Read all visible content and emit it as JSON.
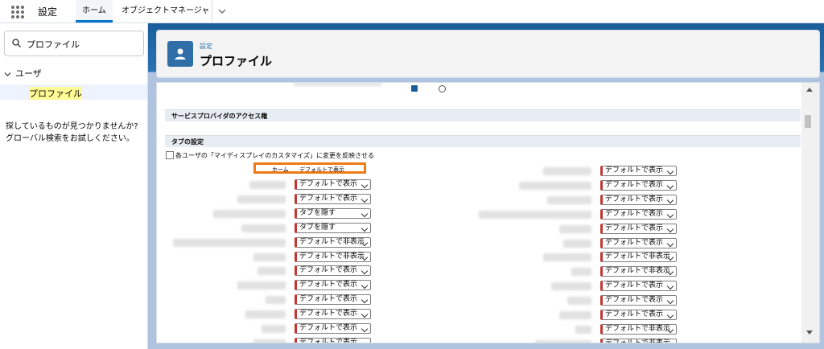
{
  "topbar": {
    "app_name": "設定",
    "tabs": [
      "ホーム",
      "オブジェクトマネージャ"
    ]
  },
  "sidebar": {
    "search_value": "プロファイル",
    "tree_parent": "ユーザ",
    "tree_child": "プロファイル",
    "help_line1": "探しているものが見つかりませんか?",
    "help_line2": "グローバル検索をお試しください。"
  },
  "header": {
    "eyebrow": "設定",
    "title": "プロファイル"
  },
  "content": {
    "section_sp": "サービスプロバイダのアクセス権",
    "section_tab": "タブの設定",
    "reflect_label": "各ユーザの「マイディスプレイのカスタマイズ」に変更を反映させる",
    "home_label": "ホーム",
    "home_value": "デフォルトで表示",
    "left_selects": [
      "デフォルトで表示",
      "デフォルトで表示",
      "タブを隠す",
      "タブを隠す",
      "デフォルトで非表示",
      "デフォルトで非表示",
      "デフォルトで表示",
      "デフォルトで表示",
      "デフォルトで表示",
      "デフォルトで表示",
      "デフォルトで表示",
      "デフォルトで表示"
    ],
    "right_selects": [
      "デフォルトで表示",
      "デフォルトで表示",
      "デフォルトで表示",
      "デフォルトで表示",
      "デフォルトで表示",
      "デフォルトで表示",
      "デフォルトで非表示",
      "デフォルトで非表示",
      "デフォルトで表示",
      "デフォルトで表示",
      "デフォルトで表示",
      "デフォルトで非表示",
      "デフォルトで非表示"
    ]
  }
}
